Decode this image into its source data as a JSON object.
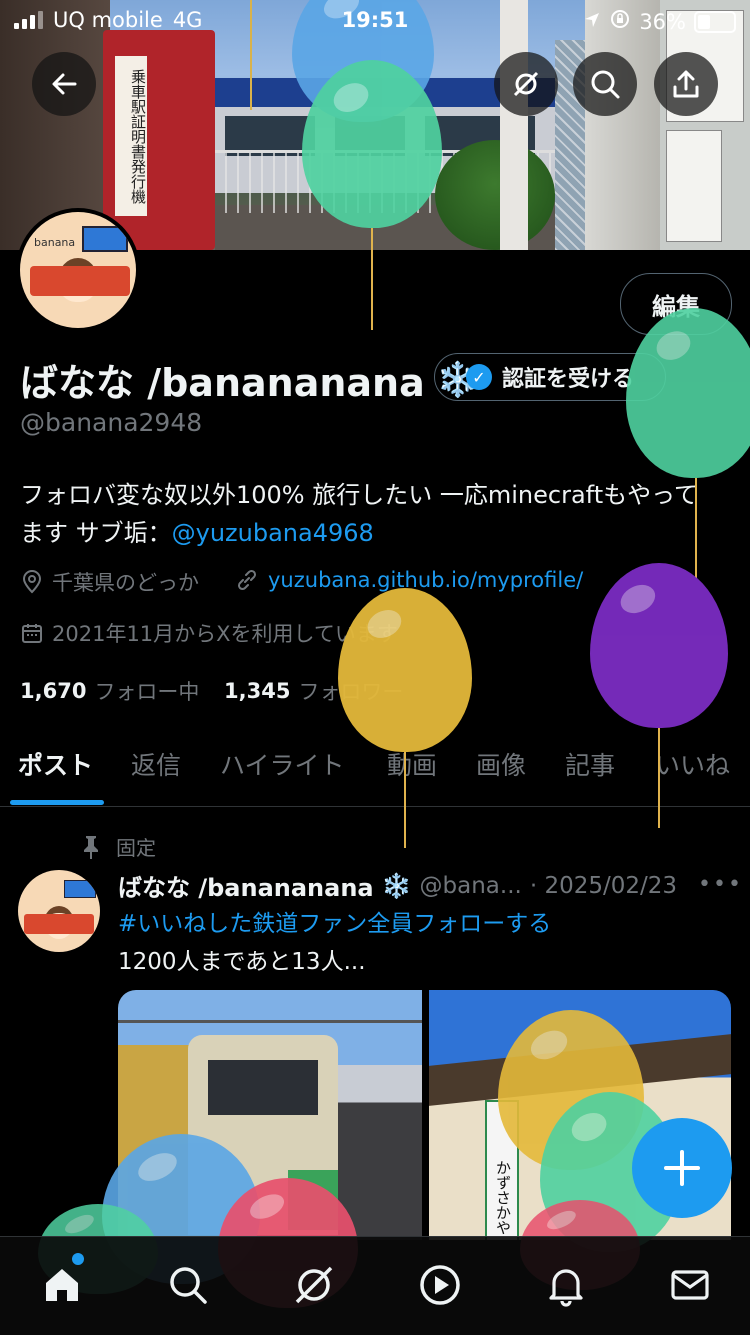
{
  "status": {
    "carrier": "UQ mobile",
    "network": "4G",
    "time": "19:51",
    "battery": "36%"
  },
  "banner": {
    "sign_text": "乗車駅証明書発行機"
  },
  "profile": {
    "edit_label": "編集",
    "name": "ばなな /banananana",
    "name_emoji": "❄️",
    "verify_label": "認証を受ける",
    "handle": "@banana2948",
    "bio_text": "フォロバ変な奴以外100% 旅行したい 一応minecraftもやってます サブ垢：",
    "bio_link": "@yuzubana4968",
    "location": "千葉県のどっか",
    "website": "yuzubana.github.io/myprofile/",
    "joined": "2021年11月からXを利用しています",
    "following_count": "1,670",
    "following_label": "フォロー中",
    "followers_count": "1,345",
    "followers_label": "フォロワー"
  },
  "tabs": [
    "ポスト",
    "返信",
    "ハイライト",
    "動画",
    "画像",
    "記事",
    "いいね"
  ],
  "pinned_post": {
    "pinned_label": "固定",
    "author_name": "ばなな /banananana",
    "author_emoji": "❄️",
    "author_handle": "@bana...",
    "date": "· 2025/02/23",
    "hashtag": "#いいねした鉄道ファン全員フォローする",
    "text": "1200人まであと13人...",
    "station_sign": "かずさかや"
  },
  "avatar_label": "banana",
  "colors": {
    "accent": "#1d9bf0",
    "balloon_blue": "#5aa6e6",
    "balloon_green": "#4fd1a0",
    "balloon_yellow": "#e4b93a",
    "balloon_purple": "#7b2cc2",
    "balloon_pink": "#e8506d"
  }
}
